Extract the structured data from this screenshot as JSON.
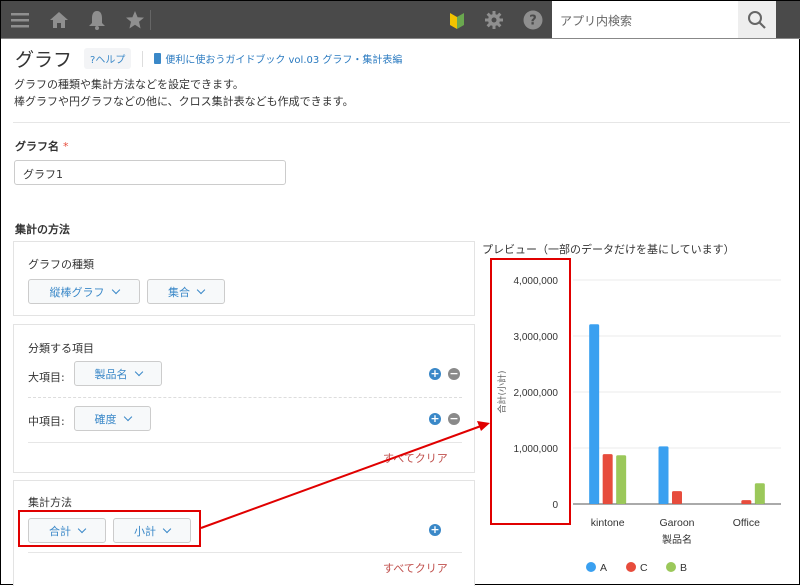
{
  "topbar": {
    "icons": [
      "menu-icon",
      "home-icon",
      "bell-icon",
      "star-icon",
      "beginner-mark-icon",
      "gear-icon",
      "help-icon"
    ],
    "search_placeholder": "アプリ内検索"
  },
  "header": {
    "title": "グラフ",
    "help_label": "?ヘルプ",
    "guide_link": "便利に使おうガイドブック vol.03 グラフ・集計表編"
  },
  "description": {
    "line1": "グラフの種類や集計方法などを設定できます。",
    "line2": "棒グラフや円グラフなどの他に、クロス集計表なども作成できます。"
  },
  "graph_name": {
    "label": "グラフ名",
    "required_mark": "*",
    "value": "グラフ1"
  },
  "method": {
    "section_label": "集計の方法",
    "graph_type": {
      "label": "グラフの種類",
      "type_value": "縦棒グラフ",
      "mode_value": "集合"
    },
    "classification": {
      "label": "分類する項目",
      "major_label": "大項目:",
      "major_value": "製品名",
      "middle_label": "中項目:",
      "middle_value": "確度",
      "clear_label": "すべてクリア"
    },
    "aggregation": {
      "label": "集計方法",
      "func_value": "合計",
      "field_value": "小計",
      "clear_label": "すべてクリア"
    }
  },
  "preview": {
    "title": "プレビュー（一部のデータだけを基にしています）"
  },
  "chart_data": {
    "type": "bar",
    "title": "",
    "xlabel": "製品名",
    "ylabel": "合計(小計)",
    "categories": [
      "kintone",
      "Garoon",
      "Office"
    ],
    "series": [
      {
        "name": "A",
        "color": "#3aa0f0",
        "values": [
          3210000,
          1030000,
          0
        ]
      },
      {
        "name": "C",
        "color": "#e74c3c",
        "values": [
          890000,
          230000,
          70000
        ]
      },
      {
        "name": "B",
        "color": "#9bc85a",
        "values": [
          870000,
          0,
          370000
        ]
      }
    ],
    "ylim": [
      0,
      4000000
    ],
    "yticks": [
      "0",
      "1,000,000",
      "2,000,000",
      "3,000,000",
      "4,000,000"
    ],
    "grid": true,
    "legend": "bottom"
  },
  "annotation": {
    "color": "#e00000"
  }
}
